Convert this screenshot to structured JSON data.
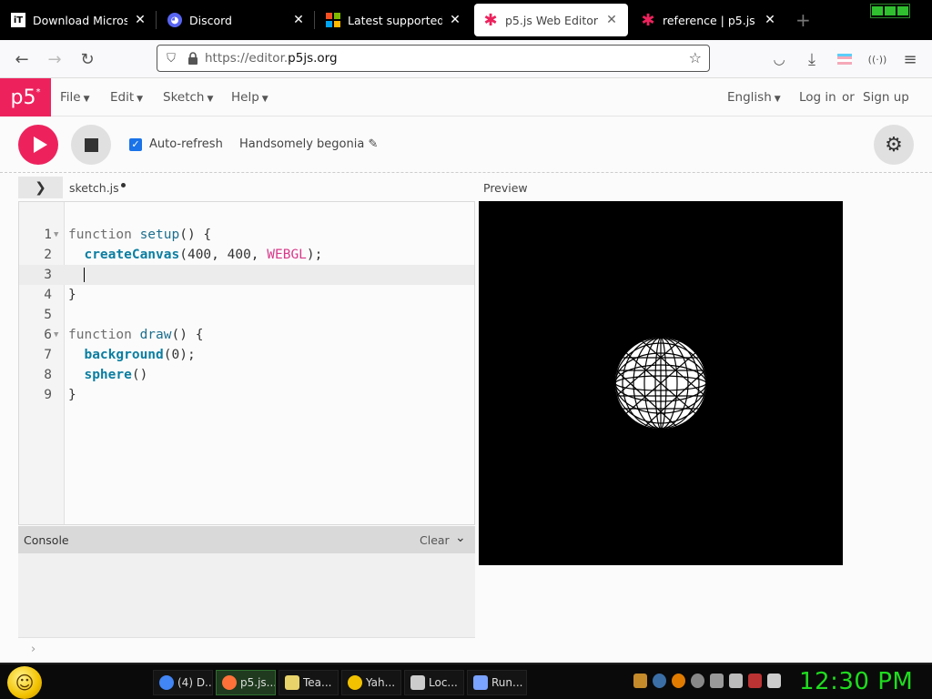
{
  "tabs": [
    {
      "title": "Download Microsoft V",
      "icon": "it-icon",
      "color": "#ffffff"
    },
    {
      "title": "Discord",
      "icon": "discord-icon",
      "color": "#5865f2"
    },
    {
      "title": "Latest supported Visu",
      "icon": "microsoft-icon",
      "color": "#f25022"
    },
    {
      "title": "p5.js Web Editor",
      "icon": "p5-asterisk-icon",
      "color": "#ed225d"
    },
    {
      "title": "reference | p5.js",
      "icon": "p5-asterisk-icon",
      "color": "#ed225d"
    }
  ],
  "url": {
    "prefix": "https://editor.",
    "domain": "p5js.org"
  },
  "p5": {
    "logo": "p5",
    "menus": [
      "File",
      "Edit",
      "Sketch",
      "Help"
    ],
    "language": "English",
    "login": "Log in",
    "or": "or",
    "signup": "Sign up"
  },
  "toolbar": {
    "auto_refresh": "Auto-refresh",
    "auto_refresh_checked": true,
    "sketch_name": "Handsomely begonia"
  },
  "editor": {
    "file_name": "sketch.js",
    "preview_label": "Preview",
    "lines": [
      {
        "n": "1",
        "fold": true
      },
      {
        "n": "2"
      },
      {
        "n": "3",
        "current": true
      },
      {
        "n": "4"
      },
      {
        "n": "5"
      },
      {
        "n": "6",
        "fold": true
      },
      {
        "n": "7"
      },
      {
        "n": "8"
      },
      {
        "n": "9"
      }
    ],
    "code": {
      "l1_kw": "function",
      "l1_fn": "setup",
      "l1_rest": "() {",
      "l2_bi": "createCanvas",
      "l2_args": "(400, 400, ",
      "l2_const": "WEBGL",
      "l2_end": ");",
      "l4": "}",
      "l6_kw": "function",
      "l6_fn": "draw",
      "l6_rest": "() {",
      "l7_bi": "background",
      "l7_rest": "(0);",
      "l8_bi": "sphere",
      "l8_rest": "()",
      "l9": "}"
    }
  },
  "console": {
    "title": "Console",
    "clear": "Clear"
  },
  "taskbar": {
    "tasks": [
      {
        "label": "(4) D...",
        "icon": "chrome-icon",
        "color": "#4285f4"
      },
      {
        "label": "p5.js...",
        "icon": "firefox-icon",
        "color": "#ff7139",
        "active": true
      },
      {
        "label": "Tea...",
        "icon": "notebook-icon",
        "color": "#e8d36a"
      },
      {
        "label": "Yah...",
        "icon": "emoji-icon",
        "color": "#f2c200"
      },
      {
        "label": "Loc...",
        "icon": "document-icon",
        "color": "#cccccc"
      },
      {
        "label": "Run...",
        "icon": "run-icon",
        "color": "#7aa2ff"
      }
    ],
    "clock": "12:30 PM"
  }
}
